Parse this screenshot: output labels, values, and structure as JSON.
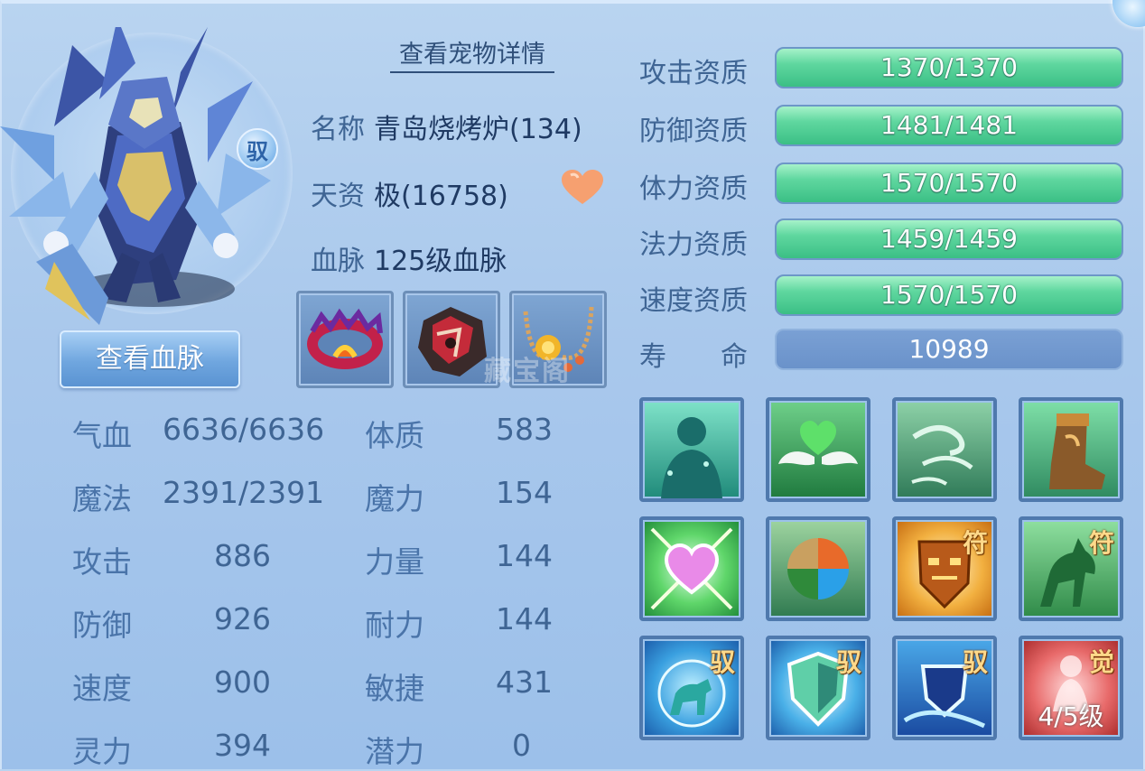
{
  "header": {
    "detail_link": "查看宠物详情"
  },
  "portrait": {
    "tame_badge": "驭"
  },
  "buttons": {
    "view_bloodline": "查看血脉"
  },
  "info": {
    "name_label": "名称",
    "name_value": "青岛烧烤炉(134)",
    "talent_label": "天资",
    "talent_value": "极(16758)",
    "bloodline_label": "血脉",
    "bloodline_value": "125级血脉"
  },
  "stats": {
    "hp_label": "气血",
    "hp_value": "6636/6636",
    "mp_label": "魔法",
    "mp_value": "2391/2391",
    "atk_label": "攻击",
    "atk_value": "886",
    "def_label": "防御",
    "def_value": "926",
    "spd_label": "速度",
    "spd_value": "900",
    "spirit_label": "灵力",
    "spirit_value": "394",
    "con_label": "体质",
    "con_value": "583",
    "mag_label": "魔力",
    "mag_value": "154",
    "str_label": "力量",
    "str_value": "144",
    "end_label": "耐力",
    "end_value": "144",
    "agi_label": "敏捷",
    "agi_value": "431",
    "pot_label": "潜力",
    "pot_value": "0"
  },
  "aptitudes": [
    {
      "label": "攻击资质",
      "value": "1370/1370",
      "fill": 1.0
    },
    {
      "label": "防御资质",
      "value": "1481/1481",
      "fill": 1.0
    },
    {
      "label": "体力资质",
      "value": "1570/1570",
      "fill": 1.0
    },
    {
      "label": "法力资质",
      "value": "1459/1459",
      "fill": 1.0
    },
    {
      "label": "速度资质",
      "value": "1570/1570",
      "fill": 1.0
    }
  ],
  "lifespan": {
    "label": "寿　　命",
    "value": "10989"
  },
  "skills": {
    "tag_fu": "符",
    "tag_yu": "驭",
    "tag_jue": "觉",
    "awaken_level": "4/5级"
  },
  "watermark": "藏宝阁",
  "colors": {
    "aptitude_fill": "#5fd79f",
    "text": "#3f6594"
  }
}
